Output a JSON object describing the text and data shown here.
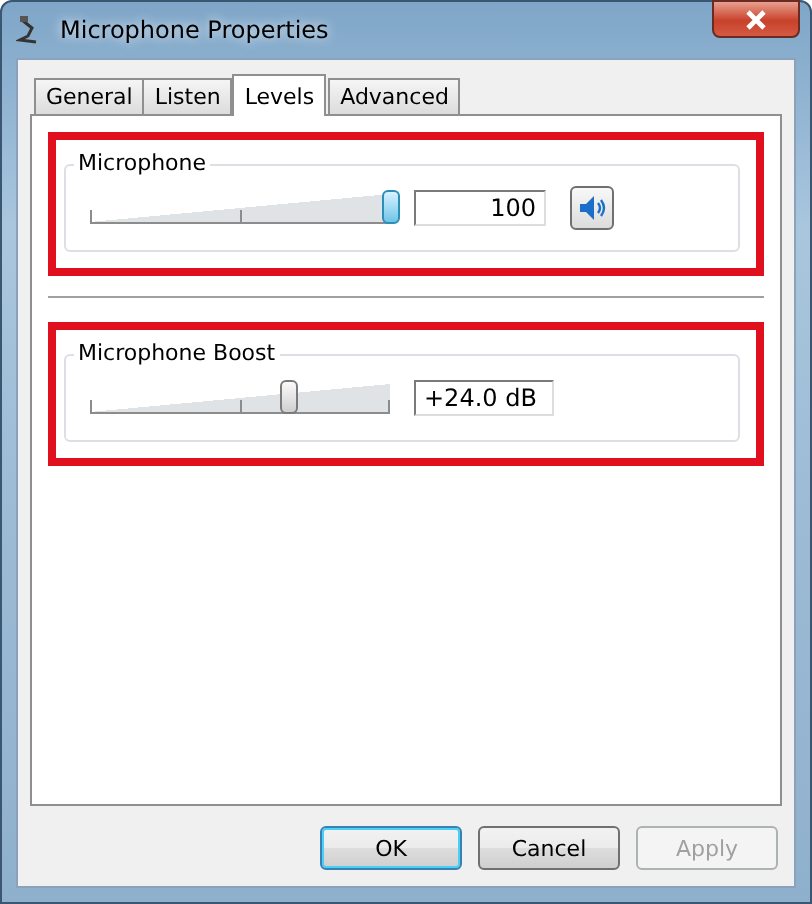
{
  "window": {
    "title": "Microphone Properties"
  },
  "tabs": [
    {
      "label": "General",
      "selected": false
    },
    {
      "label": "Listen",
      "selected": false
    },
    {
      "label": "Levels",
      "selected": true
    },
    {
      "label": "Advanced",
      "selected": false
    }
  ],
  "levels": [
    {
      "kind": "volume",
      "name": "Microphone",
      "level": 1.0,
      "reading": "100",
      "muted": false,
      "highlighted": true
    },
    {
      "kind": "boost",
      "name": "Microphone Boost",
      "level": 0.66,
      "reading": "+24.0 dB",
      "highlighted": true
    }
  ],
  "buttons": [
    {
      "label": "OK",
      "default": true,
      "disabled": false
    },
    {
      "label": "Cancel",
      "default": false,
      "disabled": false
    },
    {
      "label": "Apply",
      "default": false,
      "disabled": true
    }
  ]
}
